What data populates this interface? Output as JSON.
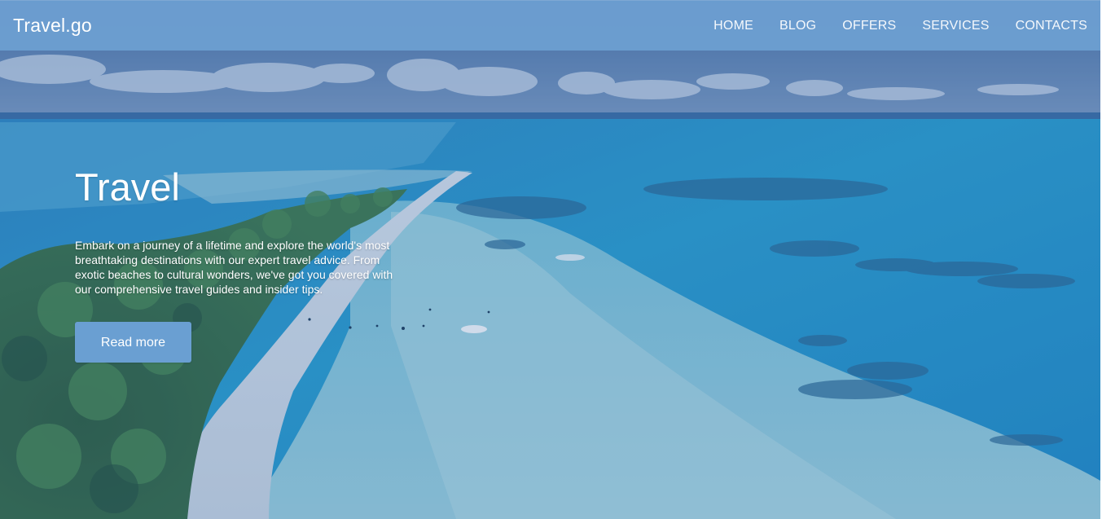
{
  "navbar": {
    "brand": "Travel.go",
    "links": [
      {
        "label": "HOME"
      },
      {
        "label": "BLOG"
      },
      {
        "label": "OFFERS"
      },
      {
        "label": "SERVICES"
      },
      {
        "label": "CONTACTS"
      }
    ]
  },
  "hero": {
    "title": "Travel",
    "description": "Embark on a journey of a lifetime and explore the world's most breathtaking destinations with our expert travel advice. From exotic beaches to cultural wonders, we've got you covered with our comprehensive travel guides and insider tips.",
    "button_label": "Read more",
    "background_image": "tropical-island-aerial-photo"
  },
  "colors": {
    "navbar_bg": "#6c9ed0",
    "button_bg": "#6a9fd2",
    "text": "#ffffff"
  }
}
